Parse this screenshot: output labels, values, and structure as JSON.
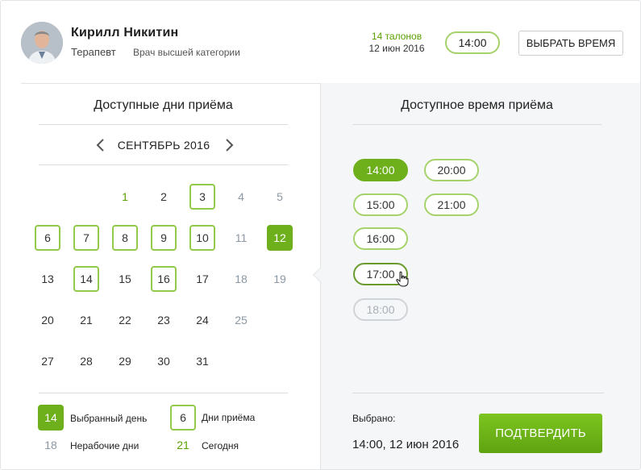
{
  "doctor": {
    "name": "Кирилл Никитин",
    "role": "Терапевт",
    "rank": "Врач высшей категории",
    "tickets": "14 талонов",
    "date": "12 июн 2016",
    "time": "14:00",
    "choose_label": "ВЫБРАТЬ ВРЕМЯ"
  },
  "calendar": {
    "title": "Доступные дни приёма",
    "month": "СЕНТЯБРЬ 2016",
    "days": [
      {
        "label": "1",
        "state": "today"
      },
      {
        "label": "2",
        "state": "normal"
      },
      {
        "label": "3",
        "state": "available"
      },
      {
        "label": "4",
        "state": "off"
      },
      {
        "label": "5",
        "state": "off"
      },
      {
        "label": "6",
        "state": "available"
      },
      {
        "label": "7",
        "state": "available"
      },
      {
        "label": "8",
        "state": "available"
      },
      {
        "label": "9",
        "state": "available"
      },
      {
        "label": "10",
        "state": "available"
      },
      {
        "label": "11",
        "state": "off"
      },
      {
        "label": "12",
        "state": "selected"
      },
      {
        "label": "13",
        "state": "normal"
      },
      {
        "label": "14",
        "state": "available"
      },
      {
        "label": "15",
        "state": "normal"
      },
      {
        "label": "16",
        "state": "available"
      },
      {
        "label": "17",
        "state": "normal"
      },
      {
        "label": "18",
        "state": "off"
      },
      {
        "label": "19",
        "state": "off"
      },
      {
        "label": "20",
        "state": "normal"
      },
      {
        "label": "21",
        "state": "normal"
      },
      {
        "label": "22",
        "state": "normal"
      },
      {
        "label": "23",
        "state": "normal"
      },
      {
        "label": "24",
        "state": "normal"
      },
      {
        "label": "25",
        "state": "off"
      },
      {
        "label": "27",
        "state": "normal"
      },
      {
        "label": "28",
        "state": "normal"
      },
      {
        "label": "29",
        "state": "normal"
      },
      {
        "label": "30",
        "state": "normal"
      },
      {
        "label": "31",
        "state": "normal"
      }
    ],
    "legend": {
      "selected_num": "14",
      "selected_label": "Выбранный день",
      "available_num": "6",
      "available_label": "Дни приёма",
      "off_num": "18",
      "off_label": "Нерабочие дни",
      "today_num": "21",
      "today_label": "Сегодня"
    }
  },
  "times": {
    "title": "Доступное время приёма",
    "slots": [
      {
        "label": "14:00",
        "state": "selected"
      },
      {
        "label": "20:00",
        "state": "available"
      },
      {
        "label": "15:00",
        "state": "available"
      },
      {
        "label": "21:00",
        "state": "available"
      },
      {
        "label": "16:00",
        "state": "available"
      },
      {
        "label": "17:00",
        "state": "hover"
      },
      {
        "label": "18:00",
        "state": "disabled"
      }
    ]
  },
  "footer": {
    "chosen_label": "Выбрано:",
    "chosen_value": "14:00, 12 июн 2016",
    "confirm_label": "ПОДТВЕРДИТЬ"
  },
  "colors": {
    "accent": "#6db01c",
    "accent_border": "#93c94a",
    "off_text": "#8b97a3",
    "panel_bg": "#f5f6f7"
  },
  "icons": {
    "prev": "chevron-left-icon",
    "next": "chevron-right-icon",
    "cursor": "hand-pointer-icon"
  }
}
